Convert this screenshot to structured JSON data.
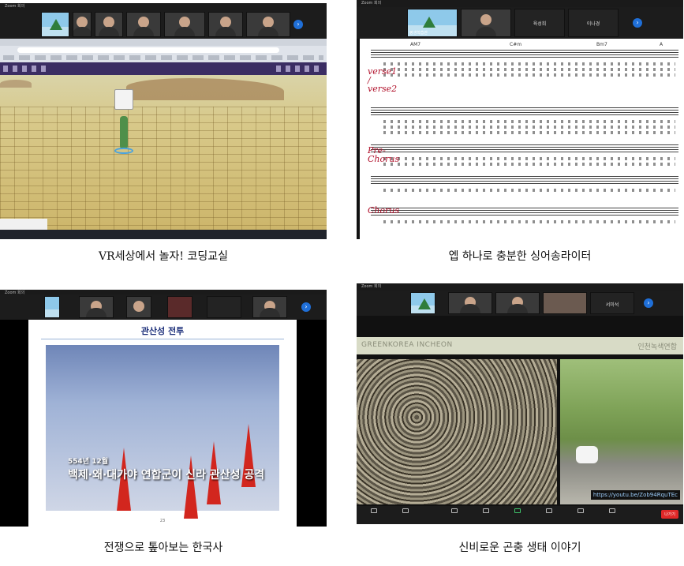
{
  "captions": {
    "vr": "VR세상에서 놀자! 코딩교실",
    "song": "엡 하나로 충분한 싱어송라이터",
    "history": "전쟁으로 톺아보는 한국사",
    "insect": "신비로운 곤충 생태 이야기"
  },
  "zoom": {
    "title": "Zoom 회의"
  },
  "song": {
    "participants": [
      "평생학습관",
      "육성희",
      "이나경"
    ],
    "annotations": {
      "verse": "verse1 / verse2",
      "prechorus": "Pre-Chorus",
      "chorus": "Chorus"
    },
    "chords": [
      "AM7",
      "C#m",
      "F#7",
      "Bm7",
      "E7",
      "A"
    ]
  },
  "history": {
    "slide_title": "관산성 전투",
    "subtitle_date": "554년 12월",
    "subtitle_main": "백제·왜·대가야 연합군이 신라 관산성 공격",
    "page": "23",
    "participants": [
      "평생학습관",
      "",
      "",
      "",
      "",
      ""
    ]
  },
  "insect": {
    "participants": [
      "평생학습관",
      "",
      "",
      "",
      "서미석"
    ],
    "brand_left": "GREENKOREA INCHEON",
    "brand_right": "인천녹색연합",
    "link": "https://youtu.be/Zob94RquTEc",
    "end_label": "나가기"
  },
  "colors": {
    "end": "#e02828",
    "zoom_blue": "#1f6fd8",
    "vr_purple": "#3b2d63"
  }
}
